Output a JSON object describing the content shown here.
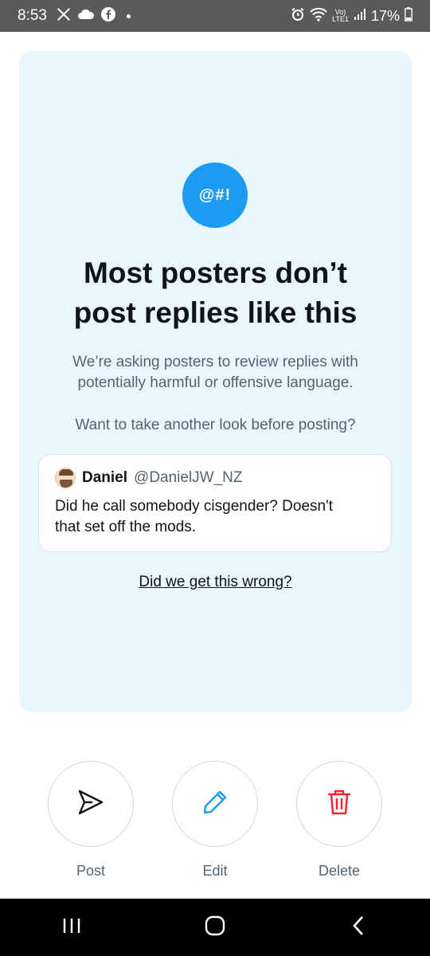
{
  "status_bar": {
    "time": "8:53",
    "icons_left": [
      "x-logo-icon",
      "cloud-icon",
      "facebook-icon",
      "dot-icon"
    ],
    "volte_top": "Vo)",
    "volte_bottom": "LTE1",
    "battery": "17%",
    "icons_right": [
      "alarm-icon",
      "wifi-icon",
      "signal-icon",
      "battery-icon"
    ]
  },
  "prompt": {
    "badge": "@#!",
    "headline_line1": "Most posters don’t",
    "headline_line2": "post replies like this",
    "description_line1": "We’re asking posters to review replies with",
    "description_line2": "potentially harmful or offensive language.",
    "question": "Want to take another look before posting?",
    "link": "Did we get this wrong?"
  },
  "tweet": {
    "author": "Daniel",
    "handle": "@DanielJW_NZ",
    "text_line1": "Did he call somebody cisgender? Doesn't",
    "text_line2": "that set off the mods."
  },
  "actions": [
    {
      "label": "Post",
      "icon": "send-icon"
    },
    {
      "label": "Edit",
      "icon": "pencil-icon"
    },
    {
      "label": "Delete",
      "icon": "trash-icon"
    }
  ],
  "colors": {
    "accent": "#1d9bf0",
    "card_bg": "#e8f6fd",
    "delete": "#f4212e",
    "text_primary": "#0f1419",
    "text_secondary": "#536471"
  }
}
